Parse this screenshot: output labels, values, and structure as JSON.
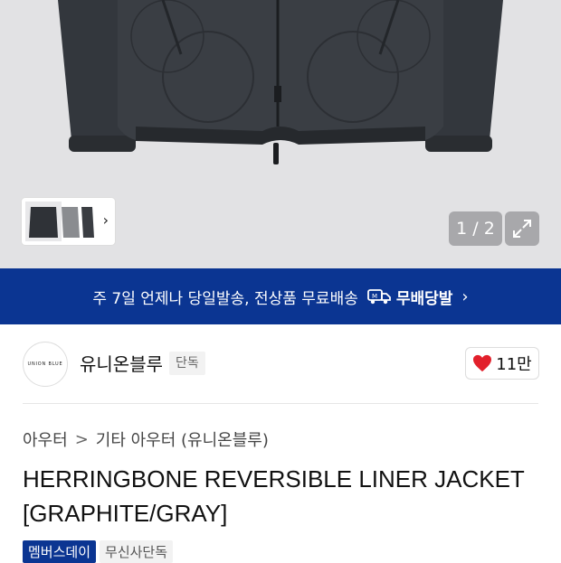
{
  "gallery": {
    "counter": "1 / 2",
    "thumbnail_chevron": "›"
  },
  "delivery_banner": {
    "text": "주 7일 언제나 당일발송, 전상품 무료배송",
    "badge": "무배당발",
    "chevron": "›"
  },
  "brand": {
    "logo_text": "UNION BLUE",
    "name": "유니온블루",
    "exclusive_tag": "단독",
    "likes": "11만",
    "like_color": "#e2202b"
  },
  "breadcrumb": {
    "level1": "아우터",
    "separator": ">",
    "level2": "기타 아우터 (유니온블루)"
  },
  "product": {
    "title": "HERRINGBONE REVERSIBLE LINER JACKET [GRAPHITE/GRAY]"
  },
  "tags": {
    "membership": "멤버스데이",
    "exclusive": "무신사단독"
  },
  "colors": {
    "banner_bg": "#0b3592",
    "hero_bg": "#e2e2e4"
  }
}
